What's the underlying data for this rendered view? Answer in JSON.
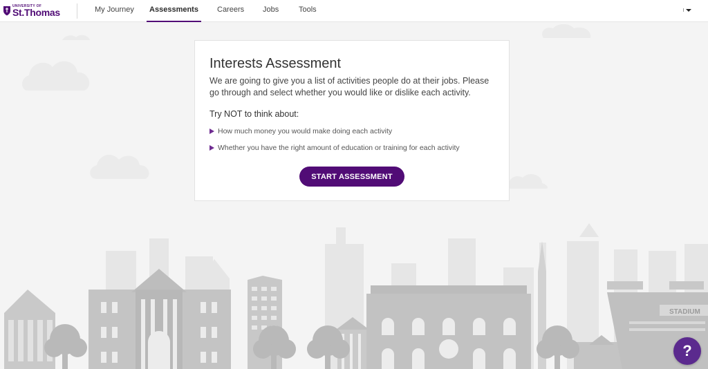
{
  "brand": {
    "logo_small_text": "UNIVERSITY OF",
    "logo_text": "St.Thomas",
    "color": "#510c76"
  },
  "nav": {
    "items": [
      {
        "label": "My Journey",
        "active": false
      },
      {
        "label": "Assessments",
        "active": true
      },
      {
        "label": "Careers",
        "active": false
      },
      {
        "label": "Jobs",
        "active": false
      },
      {
        "label": "Tools",
        "active": false
      }
    ],
    "user_menu_icon": "caret-down-icon"
  },
  "card": {
    "title": "Interests Assessment",
    "intro": "We are going to give you a list of activities people do at their jobs. Please go through and select whether you would like or dislike each activity.",
    "subhead": "Try NOT to think about:",
    "bullets": [
      "How much money you would make doing each activity",
      "Whether you have the right amount of education or training for each activity"
    ],
    "bullet_icon": "triangle-right-icon",
    "start_button_label": "START ASSESSMENT"
  },
  "illustration": {
    "stadium_sign": "STADIUM"
  },
  "help": {
    "label": "?",
    "icon": "help-icon"
  },
  "colors": {
    "accent": "#510c76",
    "help": "#5b2a8e",
    "background": "#f4f4f4"
  }
}
